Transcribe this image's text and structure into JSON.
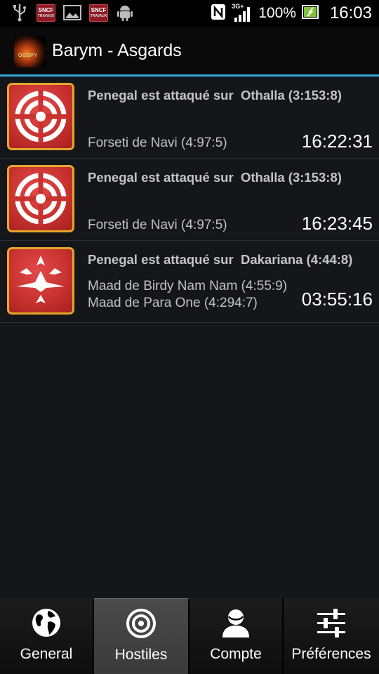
{
  "status_bar": {
    "left_icons": [
      "usb-icon",
      "sncf-icon",
      "picture-icon",
      "sncf-icon",
      "android-icon"
    ],
    "sncf_label": "SNCF",
    "sncf_sub": "TRAVAUX",
    "network": "3G+",
    "battery": "100%",
    "time": "16:03"
  },
  "header": {
    "title": "Barym - Asgards",
    "logo_text": "OGSPY"
  },
  "alerts": [
    {
      "title": "Penegal est attaqué sur  Othalla (3:153:8)",
      "attackers": [
        "Forseti de Navi (4:97:5)"
      ],
      "time": "16:22:31",
      "icon": "target-icon"
    },
    {
      "title": "Penegal est attaqué sur  Othalla (3:153:8)",
      "attackers": [
        "Forseti de Navi (4:97:5)"
      ],
      "time": "16:23:45",
      "icon": "target-icon"
    },
    {
      "title": "Penegal est attaqué sur  Dakariana (4:44:8)",
      "attackers": [
        "Maad de Birdy Nam Nam (4:55:9)",
        "Maad de Para One (4:294:7)"
      ],
      "time": "03:55:16",
      "icon": "fleet-icon"
    }
  ],
  "tabs": [
    {
      "label": "General",
      "icon": "globe-icon",
      "active": false
    },
    {
      "label": "Hostiles",
      "icon": "target-icon",
      "active": true
    },
    {
      "label": "Compte",
      "icon": "user-icon",
      "active": false
    },
    {
      "label": "Préférences",
      "icon": "sliders-icon",
      "active": false
    }
  ],
  "colors": {
    "accent": "#33a7d8",
    "icon_red": "#c8322f",
    "icon_border": "#e3a72c"
  }
}
